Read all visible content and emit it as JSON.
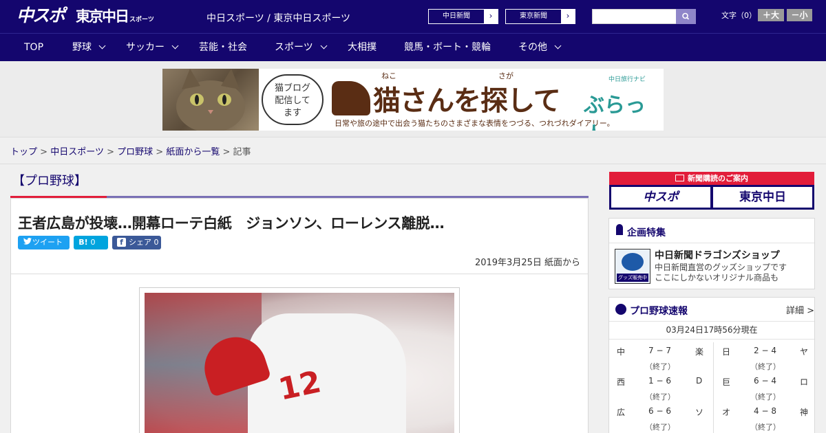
{
  "header": {
    "logo_main": "中スポ",
    "logo_tokyo": "東京中日",
    "logo_tokyo_small": "スポーツ",
    "site_title": "中日スポーツ / 東京中日スポーツ",
    "paper_buttons": [
      {
        "label": "中日新聞",
        "arrow": "›"
      },
      {
        "label": "東京新聞",
        "arrow": "›"
      }
    ],
    "search": {
      "placeholder": "",
      "icon": "search-icon"
    },
    "font_size": {
      "label": "文字（0）",
      "increase": "＋大",
      "decrease": "－小"
    }
  },
  "nav": {
    "items": [
      {
        "label": "TOP",
        "dropdown": false
      },
      {
        "label": "野球",
        "dropdown": true
      },
      {
        "label": "サッカー",
        "dropdown": true
      },
      {
        "label": "芸能・社会",
        "dropdown": false
      },
      {
        "label": "スポーツ",
        "dropdown": true
      },
      {
        "label": "大相撲",
        "dropdown": false
      },
      {
        "label": "競馬・ボート・競輪",
        "dropdown": false
      },
      {
        "label": "その他",
        "dropdown": true
      }
    ]
  },
  "banner": {
    "speech": "猫ブログ\n配信して\nます",
    "headline": "猫さんを探して",
    "headline_ruby_1": "ねこ",
    "headline_ruby_2": "さが",
    "subtext": "日常や旅の途中で出会う猫たちのさまざまな表情をつづる、つれづれダイアリー。",
    "brand_small": "中日旅行ナビ",
    "brand": "ぶらっ人"
  },
  "breadcrumb": {
    "items": [
      "トップ",
      "中日スポーツ",
      "プロ野球",
      "紙面から一覧"
    ],
    "current": "記事",
    "separator": ">"
  },
  "article": {
    "category": "【プロ野球】",
    "title": "王者広島が投壊…開幕ローテ白紙　ジョンソン、ローレンス離脱…",
    "share": {
      "tweet": "ツイート",
      "hatena": "0",
      "hatena_icon": "B!",
      "facebook": "シェア 0",
      "facebook_icon": "f"
    },
    "date": "2019年3月25日 紙面から",
    "photo_number": "12"
  },
  "sidebar": {
    "subscription": {
      "header": "新聞購読のご案内",
      "logos": [
        "中スポ",
        "東京中日"
      ]
    },
    "feature": {
      "heading": "企画特集",
      "thumb_label": "グッズ販売中",
      "title": "中日新聞ドラゴンズショップ",
      "desc_line1": "中日新聞直営のグッズショップです",
      "desc_line2": "ここにしかないオリジナル商品も"
    },
    "scores": {
      "heading": "プロ野球速報",
      "detail": "詳細 >",
      "as_of": "03月24日17時56分現在",
      "games": [
        {
          "home": "中",
          "score": "7 − 7",
          "away": "楽",
          "status": "（終了）"
        },
        {
          "home": "日",
          "score": "2 − 4",
          "away": "ヤ",
          "status": "（終了）"
        },
        {
          "home": "西",
          "score": "1 − 6",
          "away": "D",
          "status": "（終了）"
        },
        {
          "home": "巨",
          "score": "6 − 4",
          "away": "ロ",
          "status": "（終了）"
        },
        {
          "home": "広",
          "score": "6 − 6",
          "away": "ソ",
          "status": "（終了）"
        },
        {
          "home": "オ",
          "score": "4 − 8",
          "away": "神",
          "status": "（終了）"
        }
      ]
    }
  }
}
